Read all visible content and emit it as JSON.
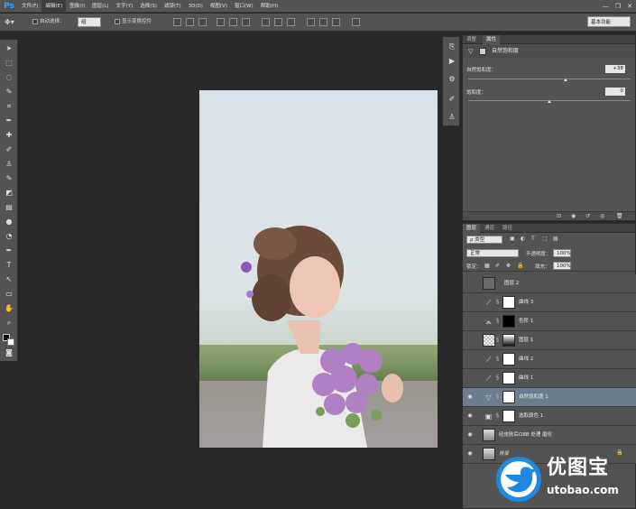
{
  "app": {
    "logo": "Ps"
  },
  "menu": [
    {
      "label": "文件(F)"
    },
    {
      "label": "编辑(E)"
    },
    {
      "label": "图像(I)"
    },
    {
      "label": "图层(L)"
    },
    {
      "label": "文字(Y)"
    },
    {
      "label": "选择(S)"
    },
    {
      "label": "滤镜(T)"
    },
    {
      "label": "3D(D)"
    },
    {
      "label": "视图(V)"
    },
    {
      "label": "窗口(W)"
    },
    {
      "label": "帮助(H)"
    }
  ],
  "window_controls": {
    "minimize": "—",
    "restore": "❐",
    "close": "✕"
  },
  "options_bar": {
    "auto_select_label": "自动选择：",
    "auto_select_value": "组",
    "transform_label": "显示变换控件",
    "workspace": "基本功能"
  },
  "properties_panel": {
    "tabs": [
      {
        "label": "调整"
      },
      {
        "label": "属性"
      }
    ],
    "title": "自然饱和度",
    "vibrance_label": "自然饱和度：",
    "vibrance_value": "+38",
    "vibrance_fraction": 0.6,
    "saturation_label": "饱和度：",
    "saturation_value": "0",
    "saturation_fraction": 0.5
  },
  "layers_panel": {
    "tabs": [
      {
        "label": "图层"
      },
      {
        "label": "通道"
      },
      {
        "label": "路径"
      }
    ],
    "filter_kind": "ρ 类型",
    "blend_mode": "正常",
    "opacity_label": "不透明度：",
    "opacity_value": "100%",
    "lock_label": "锁定：",
    "fill_label": "填充：",
    "fill_value": "100%",
    "layers": [
      {
        "name": "图层 2",
        "visible": false,
        "icon": ""
      },
      {
        "name": "曲线 3",
        "visible": false,
        "icon": "curves-icon"
      },
      {
        "name": "色阶 1",
        "visible": false,
        "icon": "levels-icon"
      },
      {
        "name": "图层 1",
        "visible": false,
        "icon": ""
      },
      {
        "name": "曲线 2",
        "visible": false,
        "icon": "curves-icon"
      },
      {
        "name": "曲线 1",
        "visible": false,
        "icon": "curves-icon"
      },
      {
        "name": "自然饱和度 1",
        "visible": true,
        "icon": "vibrance-icon"
      },
      {
        "name": "选取颜色 1",
        "visible": true,
        "icon": "selective-color-icon"
      },
      {
        "name": "经皮肤后Q8B 处理 磨化",
        "visible": true,
        "icon": ""
      },
      {
        "name": "背景",
        "visible": true,
        "icon": ""
      }
    ]
  },
  "watermark": {
    "brand": "优图宝",
    "url": "utobao.com"
  },
  "colors": {
    "accent": "#31a8ff",
    "selected_layer": "#6d7d8f",
    "watermark_blue": "#1e88e5"
  }
}
